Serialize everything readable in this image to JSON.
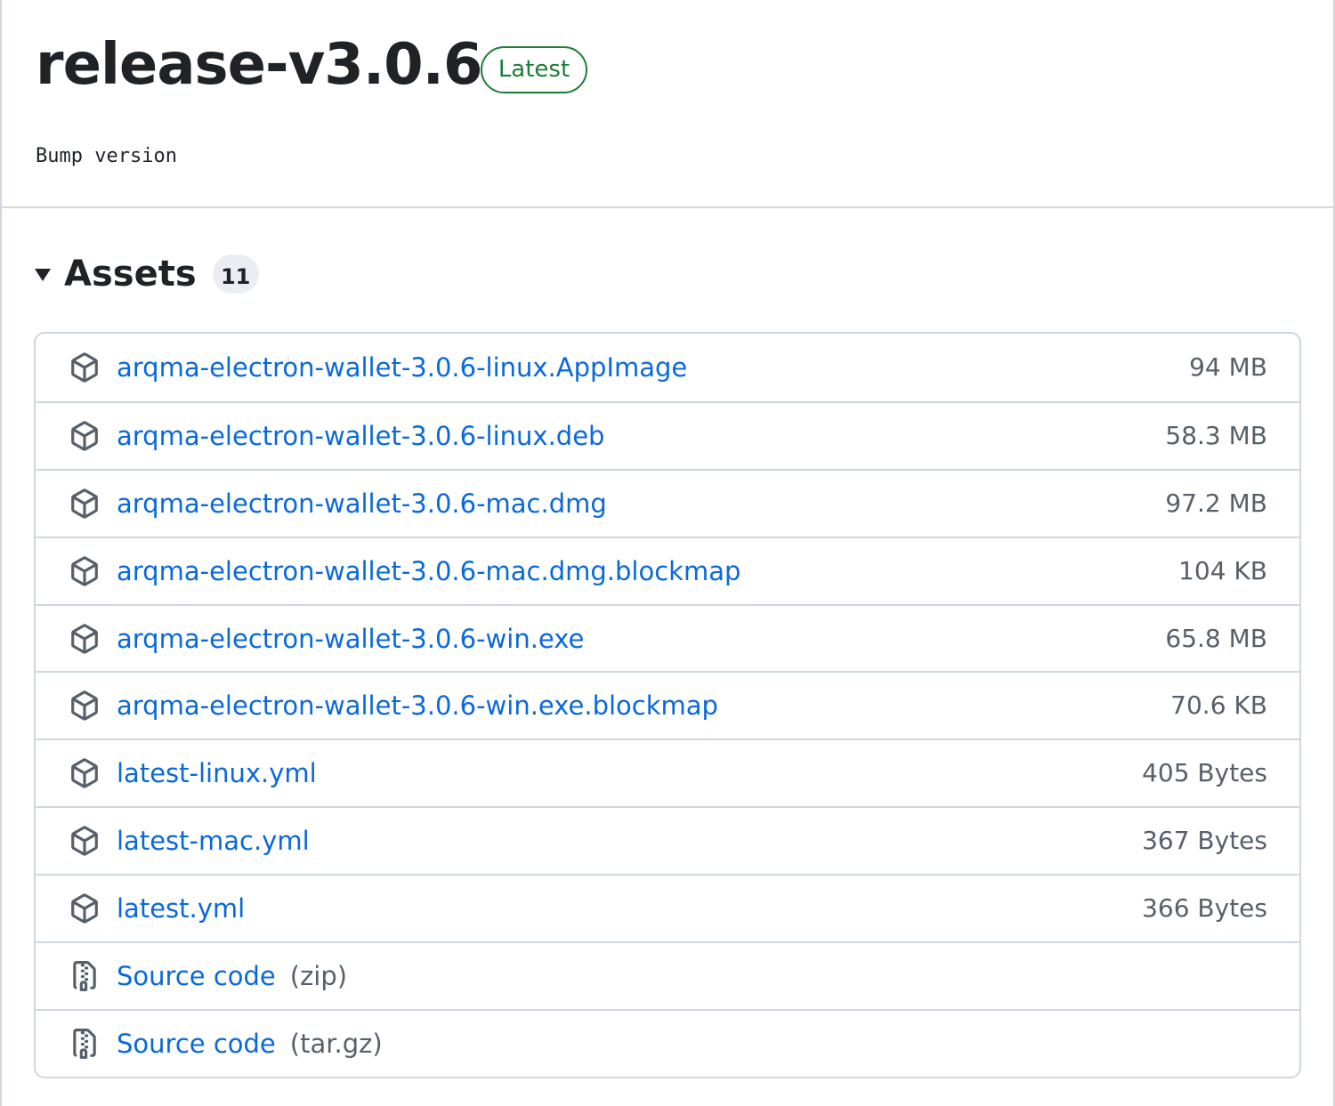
{
  "release": {
    "title": "release-v3.0.6",
    "badge": "Latest",
    "notes": "Bump version"
  },
  "assets": {
    "heading": "Assets",
    "count": "11",
    "items": [
      {
        "name": "arqma-electron-wallet-3.0.6-linux.AppImage",
        "size": "94 MB",
        "icon": "package-icon"
      },
      {
        "name": "arqma-electron-wallet-3.0.6-linux.deb",
        "size": "58.3 MB",
        "icon": "package-icon"
      },
      {
        "name": "arqma-electron-wallet-3.0.6-mac.dmg",
        "size": "97.2 MB",
        "icon": "package-icon"
      },
      {
        "name": "arqma-electron-wallet-3.0.6-mac.dmg.blockmap",
        "size": "104 KB",
        "icon": "package-icon"
      },
      {
        "name": "arqma-electron-wallet-3.0.6-win.exe",
        "size": "65.8 MB",
        "icon": "package-icon"
      },
      {
        "name": "arqma-electron-wallet-3.0.6-win.exe.blockmap",
        "size": "70.6 KB",
        "icon": "package-icon"
      },
      {
        "name": "latest-linux.yml",
        "size": "405 Bytes",
        "icon": "package-icon"
      },
      {
        "name": "latest-mac.yml",
        "size": "367 Bytes",
        "icon": "package-icon"
      },
      {
        "name": "latest.yml",
        "size": "366 Bytes",
        "icon": "package-icon"
      },
      {
        "name": "Source code",
        "suffix": "(zip)",
        "icon": "file-zip-icon"
      },
      {
        "name": "Source code",
        "suffix": "(tar.gz)",
        "icon": "file-zip-icon"
      }
    ]
  },
  "colors": {
    "link": "#0969da",
    "badge_green": "#1a7f37",
    "border": "#d0d7de",
    "muted_text": "#57606a"
  }
}
